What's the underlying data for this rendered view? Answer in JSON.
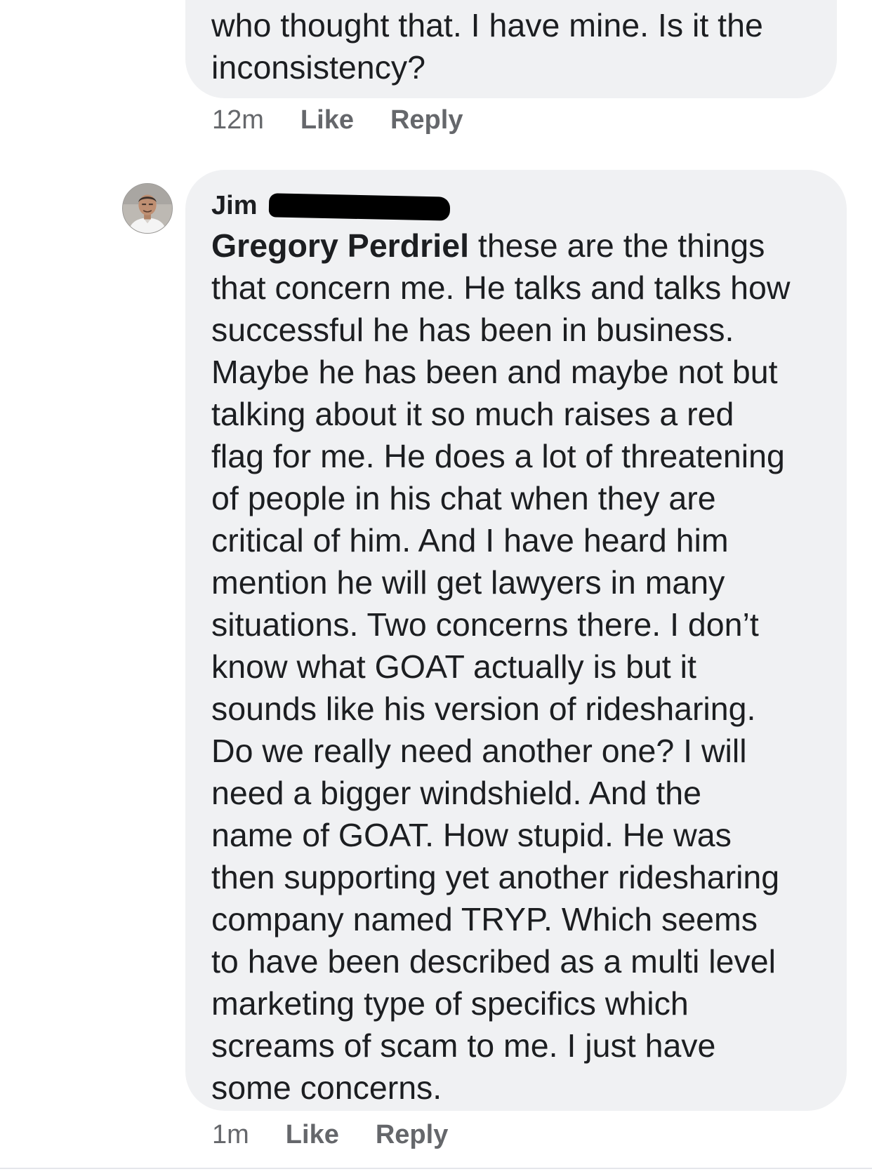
{
  "comments": {
    "previous": {
      "text_lines": [
        "who thought that. I have mine. Is it the",
        "inconsistency?"
      ],
      "time": "12m",
      "like_label": "Like",
      "reply_label": "Reply"
    },
    "current": {
      "author": "Jim",
      "mention": "Gregory Perdriel",
      "first_line_rest": " these are the things",
      "text_lines": [
        "that concern me. He talks and talks how",
        "successful he has been in business.",
        "Maybe he has been and maybe not but",
        "talking about it so much raises a red",
        "flag for me. He does a lot of threatening",
        "of people in his chat when they are",
        "critical of him. And I have heard him",
        "mention he will get lawyers in many",
        "situations. Two concerns there. I don’t",
        "know what GOAT actually is but it",
        "sounds like his version of ridesharing.",
        "Do we really need another one? I will",
        "need a bigger windshield. And the",
        "name of GOAT.  How stupid. He was",
        "then supporting yet another ridesharing",
        "company named TRYP.  Which seems",
        "to have been described as a multi level",
        "marketing type of specifics which",
        "screams of scam to me. I just have",
        "some concerns."
      ],
      "time": "1m",
      "like_label": "Like",
      "reply_label": "Reply"
    }
  },
  "colors": {
    "bubble_background": "#f0f1f3",
    "text": "#1c1e21",
    "meta_text": "#65676b",
    "redaction": "#000000"
  },
  "icons": {
    "avatar": "user-avatar-photo"
  }
}
